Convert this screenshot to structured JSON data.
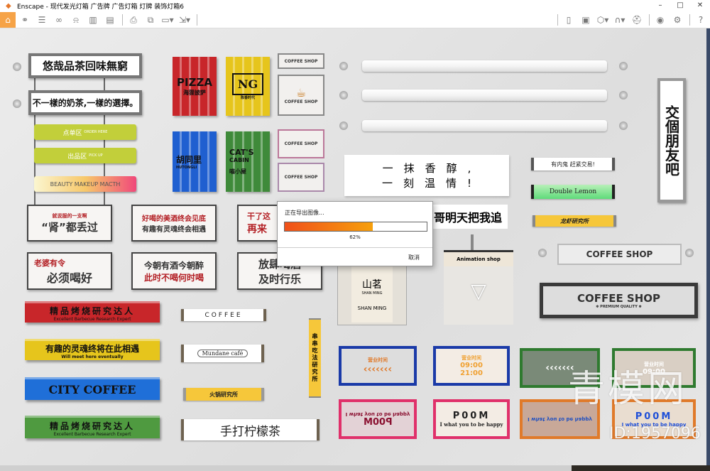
{
  "window": {
    "app": "Enscape",
    "title": "Enscape - 现代发光灯箱 广告牌 广告灯箱 灯牌 装饰灯箱6",
    "minimize": "–",
    "maximize": "□",
    "close": "✕"
  },
  "toolbar": {
    "left": [
      "home-icon",
      "link-icon",
      "bim-icon",
      "binoculars-icon",
      "bell-icon",
      "buildings-icon",
      "clapper-icon",
      "screenshot-icon",
      "batch-render-icon",
      "panorama-icon",
      "export-icon"
    ],
    "right": [
      "map-icon",
      "asset-library-icon",
      "view-cube-icon",
      "walk-icon",
      "vr-headset-icon",
      "visibility-icon",
      "settings-icon",
      "help-icon"
    ]
  },
  "signs": {
    "s1": "悠哉品茶回味無窮",
    "s2": "不一樣的奶茶,一樣的選擇。",
    "order": "点单区",
    "order_en": "ORDER HERE",
    "pick": "出品区",
    "pick_en": "PICK UP",
    "beauty": "BEAUTY MAKEUP MACTH",
    "pizza": "PIZZA",
    "pizza_cn": "海狸披萨",
    "ng": "NG",
    "ng_cn": "陈香时代",
    "hutong": "胡同里",
    "hutong_en": "HUTONGLI",
    "cats": "CAT'S",
    "cabin": "CABIN",
    "cats_cn": "喵小屋",
    "coffee_shop": "COFFEE SHOP",
    "b1a": "“肾”都丢过",
    "b1b": "就说服的一支啊",
    "b2a": "好喝的美酒终会见底",
    "b2b": "有趣有灵魂终会相遇",
    "b3a": "干了这",
    "b3b": "再来",
    "b4a": "老婆有令",
    "b4b": "必须喝好",
    "b5a": "今朝有酒今朝醉",
    "b5b": "此时不喝何时喝",
    "b6a": "放肆喝酒",
    "b6b": "及时行乐",
    "friends": "交個朋友吧",
    "yimo1": "一　抹　香　醇　,",
    "yimo2": "一　刻　温　情　!",
    "chase": "哥明天把我追",
    "neigui": "有内鬼 赶紧交易!",
    "lemon": "Double Lemon",
    "lobster": "龙虾研究所",
    "coffee_shop_2": "COFFEE SHOP",
    "coffee_shop_3": "COFFEE SHOP",
    "premium": "✽ PREMIUM QUALITY ✽",
    "shanming_cn": "山茗",
    "shanming_en": "SHAN MING",
    "shanming_en2": "SHAN MING",
    "animation": "Animation shop",
    "bbq": "精品烤烧研究达人",
    "bbq_en": "Excellent Barbecue Research Expert",
    "soul": "有趣的灵魂终将在此相遇",
    "soul_en": "Will meet here eventually",
    "city": "CITY COFFEE",
    "bbq2": "精品烤烧研究达人",
    "bbq2_en": "Excellent Barbecue Research Expert",
    "coffee": "COFFEE",
    "mundane": "Mundane café",
    "hotpot": "火锅研究所",
    "lemontea": "手打柠檬茶",
    "chuan": "串串吃法研究所",
    "hours": "营业时间",
    "open": "09:00",
    "close": "21:00",
    "room": "P00M",
    "happy": "I what you to be happy"
  },
  "colors": {
    "accent": "#f6a347",
    "red": "#c8262a",
    "yellow": "#e6c51c",
    "blue": "#1f5fd0",
    "green": "#3f8a3a",
    "pink": "#e0306a",
    "orange": "#e07a2a"
  },
  "export_dialog": {
    "title": "正在导出图像...",
    "progress_percent": 62,
    "progress_label": "62%",
    "cancel": "取消"
  },
  "watermark": {
    "brand": "青模网",
    "id": "ID:1957096"
  }
}
